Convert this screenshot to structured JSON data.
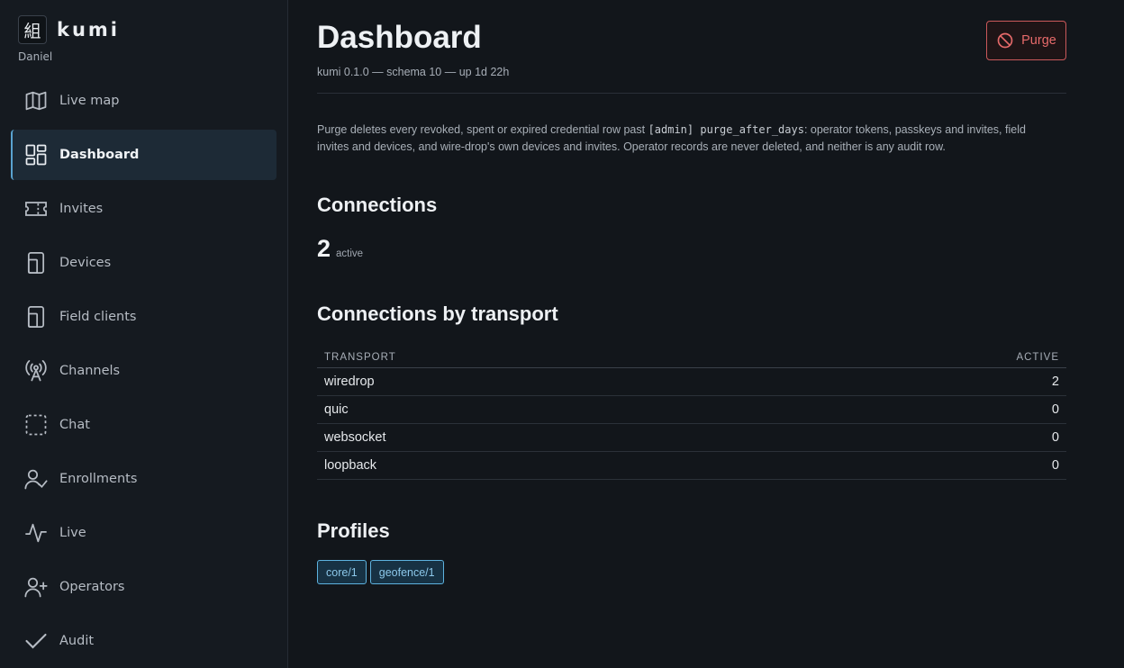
{
  "brand": {
    "logo_glyph": "組",
    "name": "kumi",
    "user": "Daniel"
  },
  "sidebar": {
    "items": [
      {
        "label": "Live map",
        "icon": "map-icon"
      },
      {
        "label": "Dashboard",
        "icon": "dashboard-icon",
        "active": true
      },
      {
        "label": "Invites",
        "icon": "ticket-icon"
      },
      {
        "label": "Devices",
        "icon": "device-icon"
      },
      {
        "label": "Field clients",
        "icon": "device-icon"
      },
      {
        "label": "Channels",
        "icon": "broadcast-icon"
      },
      {
        "label": "Chat",
        "icon": "dashed-square-icon"
      },
      {
        "label": "Enrollments",
        "icon": "user-check-icon"
      },
      {
        "label": "Live",
        "icon": "activity-icon"
      },
      {
        "label": "Operators",
        "icon": "user-plus-icon"
      },
      {
        "label": "Audit",
        "icon": "check-icon"
      }
    ]
  },
  "header": {
    "title": "Dashboard",
    "subtitle": "kumi 0.1.0 — schema 10 — up 1d 22h",
    "purge_label": "Purge"
  },
  "description": {
    "before": "Purge deletes every revoked, spent or expired credential row past ",
    "code": "[admin] purge_after_days",
    "after": ": operator tokens, passkeys and invites, field invites and devices, and wire-drop's own devices and invites. Operator records are never deleted, and neither is any audit row."
  },
  "connections": {
    "heading": "Connections",
    "count": "2",
    "unit": "active"
  },
  "transport": {
    "heading": "Connections by transport",
    "columns": [
      "TRANSPORT",
      "ACTIVE"
    ],
    "rows": [
      {
        "name": "wiredrop",
        "active": "2"
      },
      {
        "name": "quic",
        "active": "0"
      },
      {
        "name": "websocket",
        "active": "0"
      },
      {
        "name": "loopback",
        "active": "0"
      }
    ]
  },
  "profiles": {
    "heading": "Profiles",
    "tags": [
      "core/1",
      "geofence/1"
    ]
  },
  "colors": {
    "accent": "#5aa3d0",
    "danger": "#e66a6a",
    "background": "#12161b"
  }
}
